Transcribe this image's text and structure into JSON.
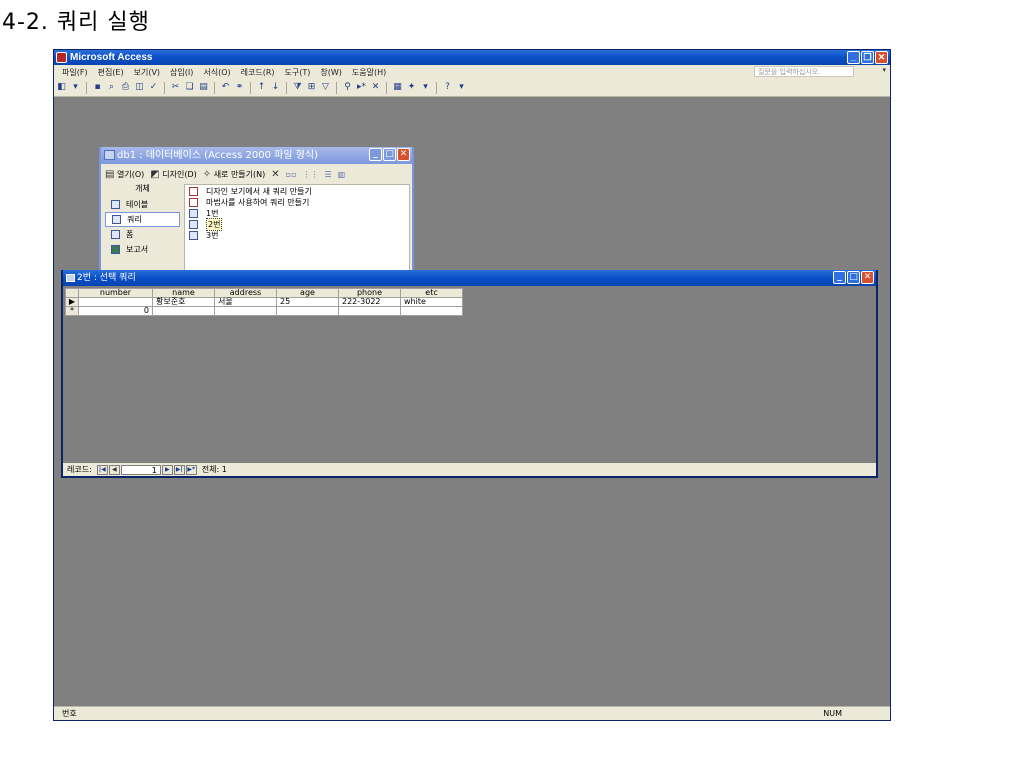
{
  "heading": "4-2.  쿼리 실행",
  "app": {
    "title": "Microsoft Access",
    "menu": [
      "파일(F)",
      "편집(E)",
      "보기(V)",
      "삽입(I)",
      "서식(O)",
      "레코드(R)",
      "도구(T)",
      "창(W)",
      "도움말(H)"
    ],
    "help_placeholder": "질문을 입력하십시오.",
    "status_left": "번호",
    "status_right": "NUM"
  },
  "db_window": {
    "title": "db1 : 데이터베이스 (Access 2000 파일 형식)",
    "toolbar": {
      "open": "열기(O)",
      "design": "디자인(D)",
      "new": "새로 만들기(N)"
    },
    "objects_header": "개체",
    "objects": [
      "테이블",
      "쿼리",
      "폼",
      "보고서"
    ],
    "selected_object": "쿼리",
    "list": [
      {
        "label": "디자인 보기에서 새 쿼리 만들기",
        "icon": "wizard-icon"
      },
      {
        "label": "마법사를 사용하여 쿼리 만들기",
        "icon": "wizard-icon"
      },
      {
        "label": "1번",
        "icon": "query-icon"
      },
      {
        "label": "2번",
        "icon": "query-icon"
      },
      {
        "label": "3번",
        "icon": "query-icon"
      }
    ]
  },
  "query_window": {
    "title": "2번 : 선택 쿼리",
    "columns": [
      "number",
      "name",
      "address",
      "age",
      "phone",
      "etc"
    ],
    "rows": [
      {
        "marker": "▶",
        "number": "",
        "name": "황보준호",
        "address": "서울",
        "age": "25",
        "phone": "222-3022",
        "etc": "white"
      },
      {
        "marker": "*",
        "number": "0",
        "name": "",
        "address": "",
        "age": "",
        "phone": "",
        "etc": ""
      }
    ],
    "nav": {
      "label": "레코드:",
      "current": "1",
      "total": "전체: 1"
    }
  }
}
